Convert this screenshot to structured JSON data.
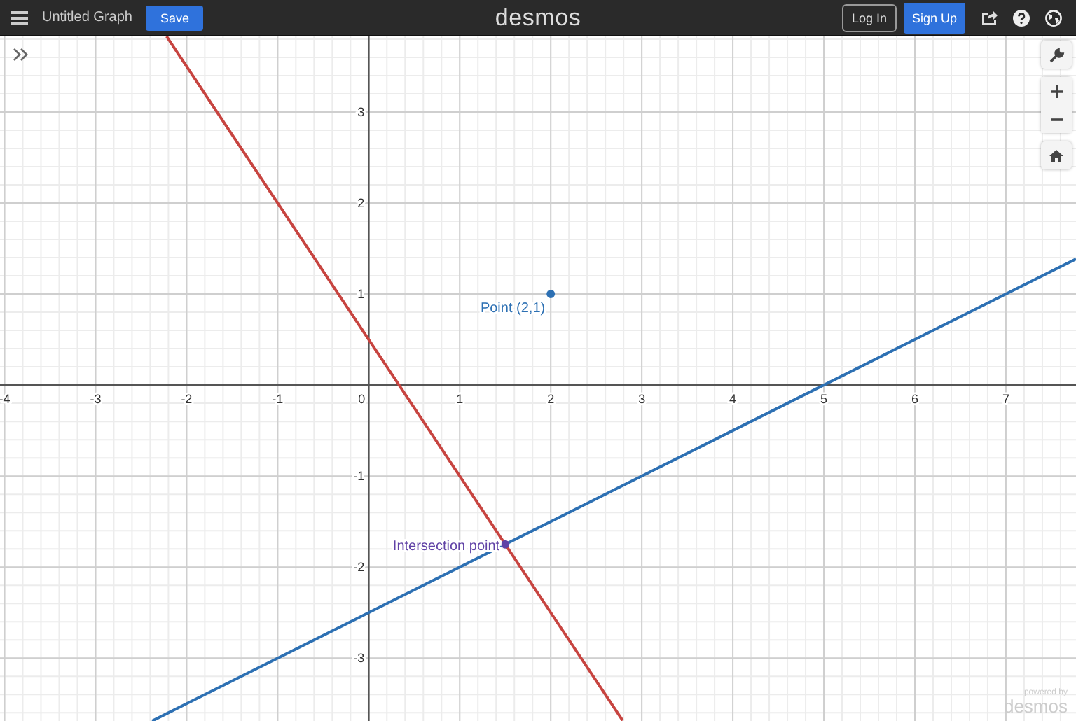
{
  "header": {
    "title": "Untitled Graph",
    "save_button": "Save",
    "logo": "desmos",
    "login_button": "Log In",
    "signup_button": "Sign Up"
  },
  "graph": {
    "chart_data": {
      "type": "line",
      "grid": true,
      "x": [
        -2.38,
        -2.22,
        -2,
        0,
        2,
        2.79,
        4,
        6,
        7.77
      ],
      "xlim": [
        -4.05,
        7.77
      ],
      "ylim": [
        -3.69,
        3.83
      ],
      "xticks": [
        -4,
        -3,
        -2,
        -1,
        0,
        1,
        2,
        3,
        4,
        5,
        6,
        7
      ],
      "yticks": [
        -3,
        -2,
        -1,
        1,
        2,
        3
      ],
      "series": [
        {
          "color": "#c74440",
          "values": [
            null,
            3.83,
            3.5,
            0.5,
            -2.5,
            -3.685,
            null,
            null,
            null
          ]
        },
        {
          "color": "#2d70b3",
          "values": [
            -3.69,
            -3.61,
            -3.5,
            -2.5,
            -1.5,
            -1.105,
            -0.5,
            0.5,
            1.385
          ]
        }
      ],
      "annotations": [
        {
          "x": 2,
          "y": 1,
          "text": "Point (2,1)"
        },
        {
          "x": 1.5,
          "y": -1.75,
          "text": "Intersection point"
        }
      ]
    }
  },
  "watermark": {
    "line_1": "powered by",
    "line_2": "desmos"
  }
}
